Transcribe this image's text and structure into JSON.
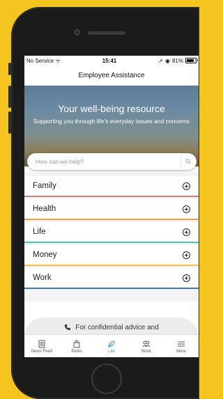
{
  "statusbar": {
    "carrier": "No Service",
    "time": "15:41",
    "battery": "81%"
  },
  "nav": {
    "title": "Employee Assistance"
  },
  "hero": {
    "title": "Your well-being resource",
    "subtitle": "Supporting you through life's everyday issues and concerns"
  },
  "search": {
    "placeholder": "How can we help?"
  },
  "categories": [
    {
      "label": "Family",
      "color": "#e07a7a"
    },
    {
      "label": "Health",
      "color": "#f0a040"
    },
    {
      "label": "Life",
      "color": "#40c8c0"
    },
    {
      "label": "Money",
      "color": "#f2c53a"
    },
    {
      "label": "Work",
      "color": "#3a76c8"
    }
  ],
  "banner": {
    "text": "For confidential advice and"
  },
  "tabs": [
    {
      "label": "News Feed",
      "icon": "news-feed-icon"
    },
    {
      "label": "Perks",
      "icon": "shopping-bag-icon"
    },
    {
      "label": "Life",
      "icon": "leaf-icon",
      "active": true
    },
    {
      "label": "Work",
      "icon": "people-icon"
    },
    {
      "label": "More",
      "icon": "menu-icon"
    }
  ],
  "colors": {
    "background": "#f5c51f",
    "active_tab": "#4a90c8"
  }
}
